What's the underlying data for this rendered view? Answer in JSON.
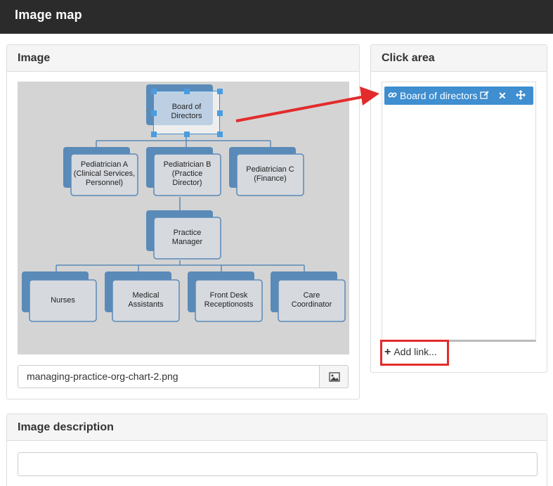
{
  "app": {
    "title": "Image map"
  },
  "image_panel": {
    "title": "Image",
    "filename": "managing-practice-org-chart-2.png",
    "browse_icon": "image-icon",
    "org_chart": {
      "background": "#d4d4d4",
      "accent": "#5a8ab8",
      "nodes": [
        {
          "line1": "Board of",
          "line2": "Directors"
        },
        {
          "line1": "Pediatrician A",
          "line2": "(Clinical Services,",
          "line3": "Personnel)"
        },
        {
          "line1": "Pediatrician B",
          "line2": "(Practice",
          "line3": "Director)"
        },
        {
          "line1": "Pediatrician C",
          "line2": "(Finance)"
        },
        {
          "line1": "Practice",
          "line2": "Manager"
        },
        {
          "line1": "Nurses"
        },
        {
          "line1": "Medical",
          "line2": "Assistants"
        },
        {
          "line1": "Front Desk",
          "line2": "Receptionosts"
        },
        {
          "line1": "Care",
          "line2": "Coordinator"
        }
      ]
    }
  },
  "click_area_panel": {
    "title": "Click area",
    "areas": [
      {
        "label": "Board of directors",
        "icons": [
          "link-icon",
          "edit-icon",
          "close-icon",
          "move-icon"
        ]
      }
    ],
    "add_link_label": "Add link...",
    "selected_color": "#3e8ed0"
  },
  "description_panel": {
    "title": "Image description",
    "value": ""
  },
  "annotation_color": "#e32b2b"
}
